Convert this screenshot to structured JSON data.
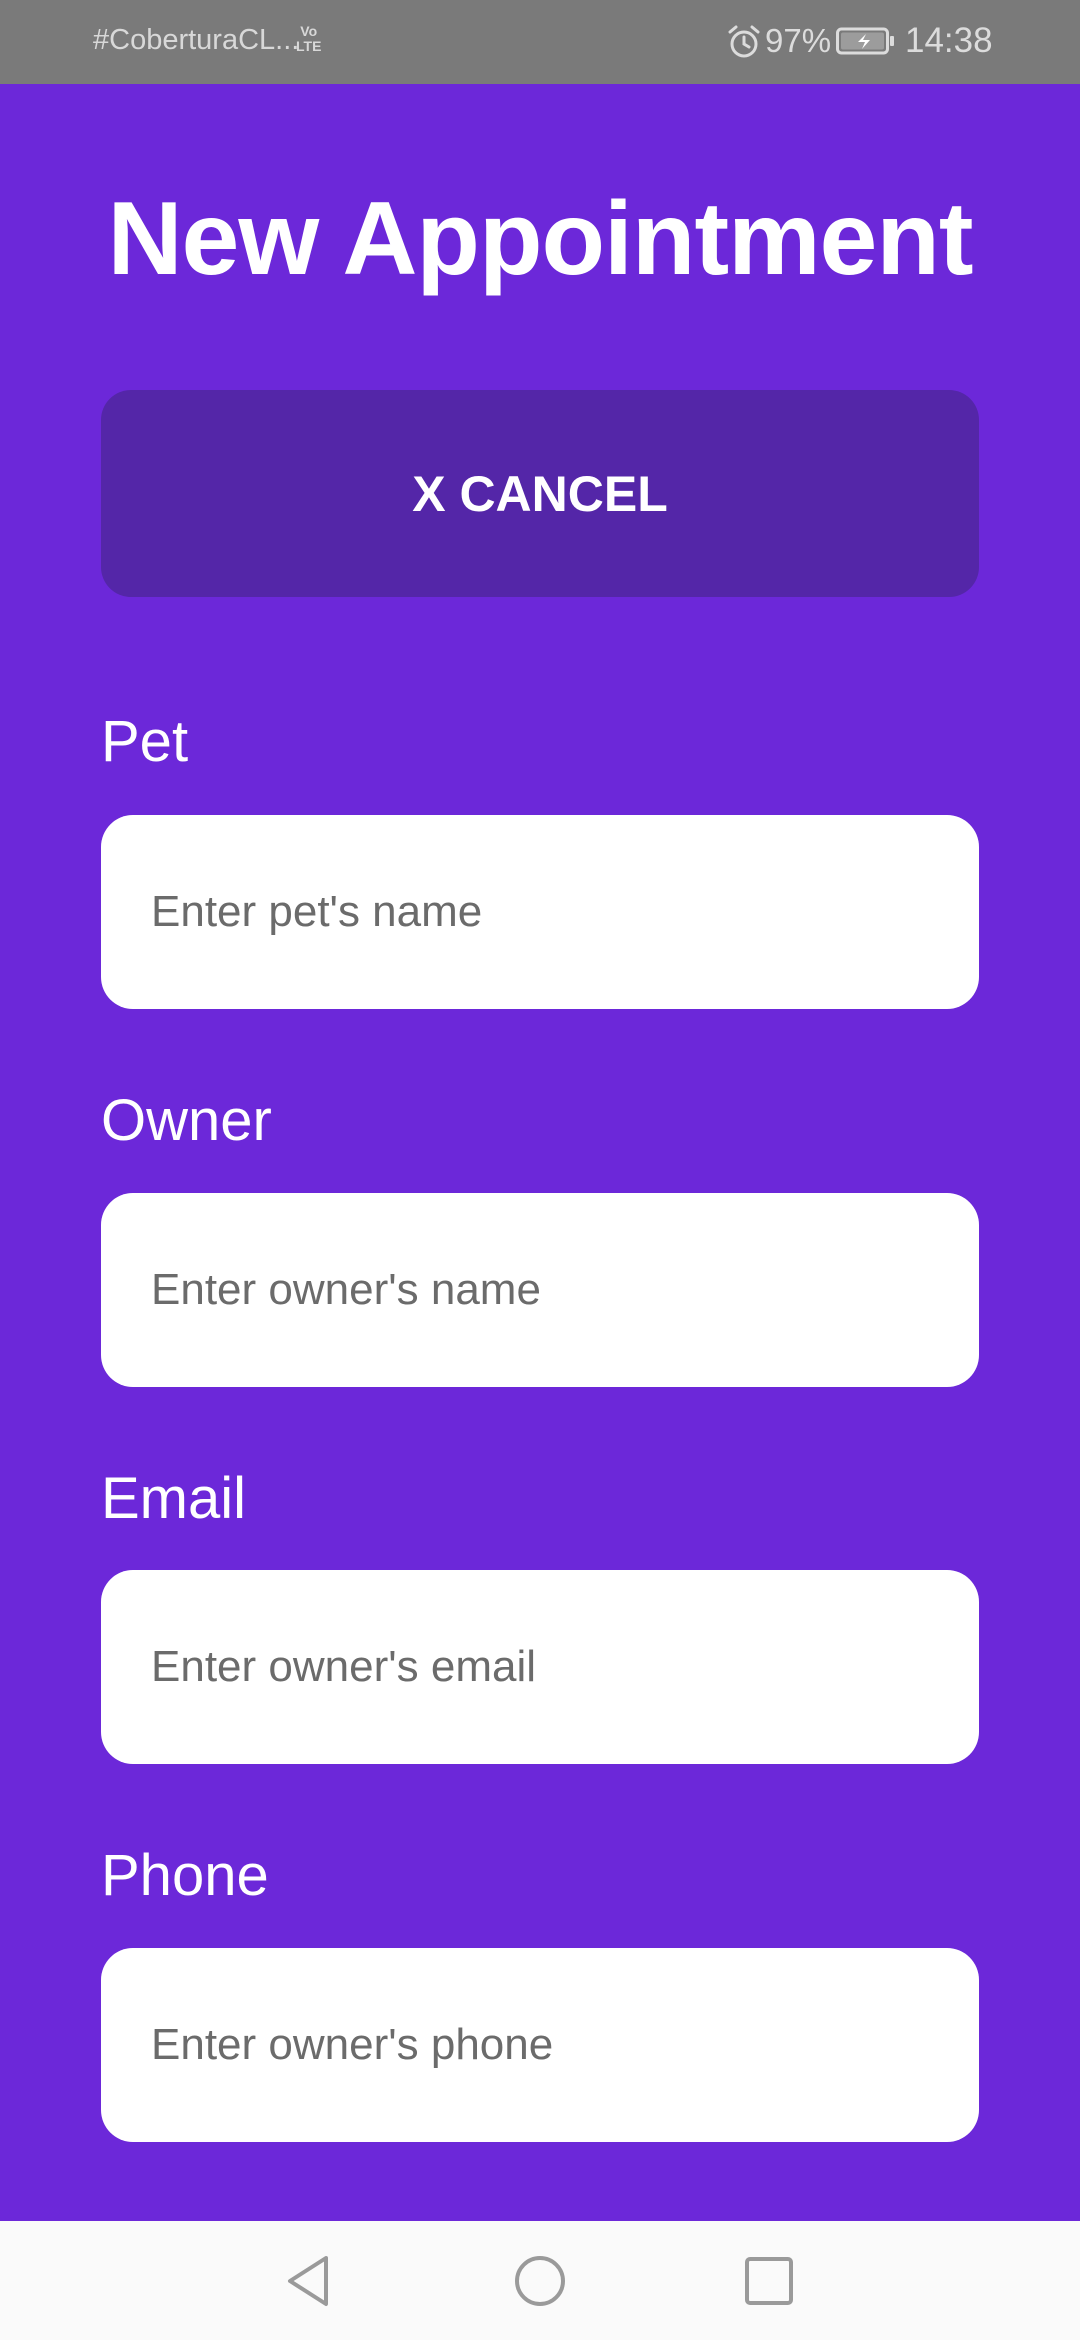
{
  "status_bar": {
    "carrier": "#CoberturaCL...",
    "volte_top": "Vo",
    "volte_bottom": "LTE",
    "battery_percent": "97%",
    "time": "14:38",
    "icons": [
      "alarm-icon",
      "battery-charging-icon"
    ]
  },
  "header": {
    "title": "New Appointment"
  },
  "actions": {
    "cancel_label": "X CANCEL"
  },
  "form": {
    "fields": [
      {
        "label": "Pet",
        "placeholder": "Enter pet's name",
        "value": ""
      },
      {
        "label": "Owner",
        "placeholder": "Enter owner's name",
        "value": ""
      },
      {
        "label": "Email",
        "placeholder": "Enter owner's email",
        "value": ""
      },
      {
        "label": "Phone",
        "placeholder": "Enter owner's phone",
        "value": ""
      }
    ]
  },
  "nav_bar": {
    "icons": [
      "back-triangle-icon",
      "home-circle-icon",
      "recents-square-icon"
    ]
  },
  "colors": {
    "background": "#6c28d9",
    "cancel_button": "#5426a8",
    "input_background": "#ffffff",
    "status_bar": "#7a7a7a",
    "nav_bar": "#fafafa"
  }
}
